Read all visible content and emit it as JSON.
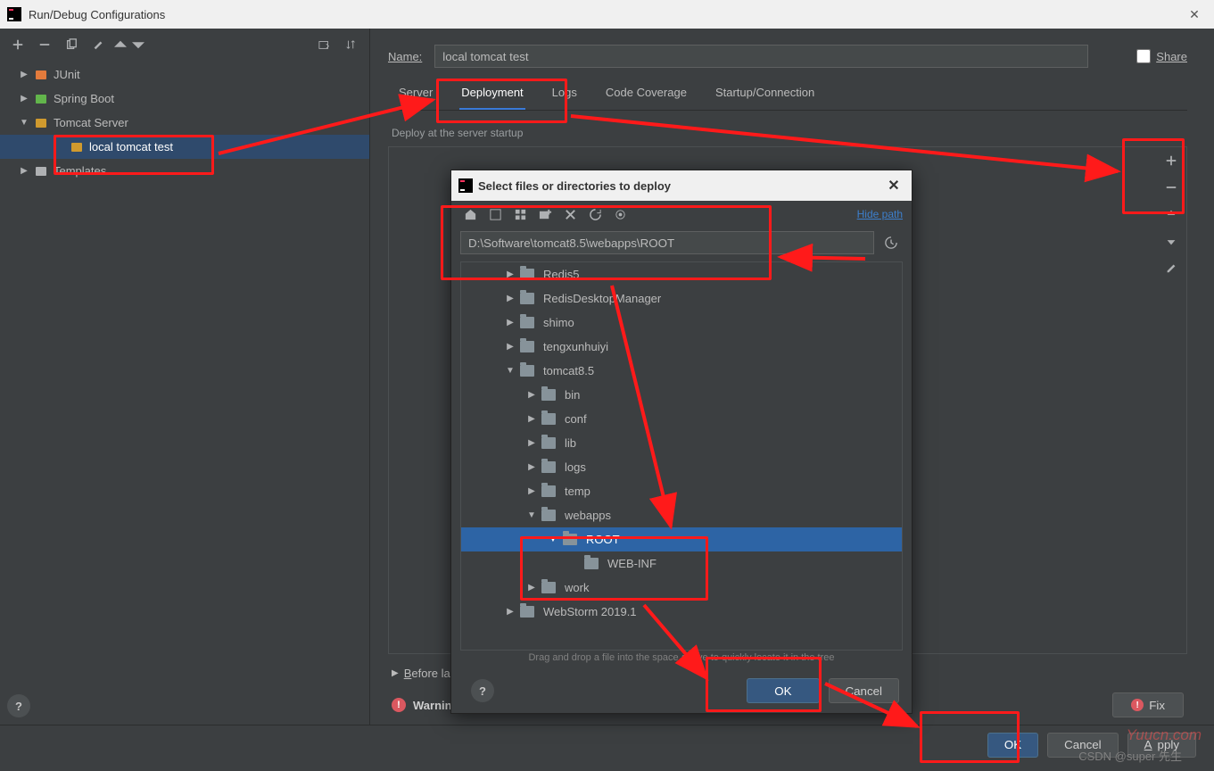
{
  "window": {
    "title": "Run/Debug Configurations"
  },
  "toolbar_icons": [
    "add",
    "remove",
    "copy",
    "wrench",
    "up",
    "down",
    "folder-move",
    "sort"
  ],
  "sidebar": {
    "items": [
      {
        "label": "JUnit",
        "level": 1,
        "arrow": "right",
        "color": "#e47b3c"
      },
      {
        "label": "Spring Boot",
        "level": 1,
        "arrow": "right",
        "color": "#62b54b"
      },
      {
        "label": "Tomcat Server",
        "level": 1,
        "arrow": "down",
        "color": "#d09a2e"
      },
      {
        "label": "local tomcat test",
        "level": 2,
        "arrow": "",
        "color": "#d09a2e",
        "selected": true
      },
      {
        "label": "Templates",
        "level": 1,
        "arrow": "right",
        "color": "#afb1b3"
      }
    ]
  },
  "form": {
    "name_label": "Name:",
    "name_value": "local tomcat test",
    "share_label": "Share"
  },
  "tabs": [
    "Server",
    "Deployment",
    "Logs",
    "Code Coverage",
    "Startup/Connection"
  ],
  "active_tab": 1,
  "deploy_section_label": "Deploy at the server startup",
  "side_tools": [
    "add",
    "remove",
    "up",
    "down",
    "edit"
  ],
  "before_launch_label": "Before launch",
  "warning_label": "Warning",
  "fix_label": "Fix",
  "buttons": {
    "ok": "OK",
    "cancel": "Cancel",
    "apply": "Apply"
  },
  "modal": {
    "title": "Select files or directories to deploy",
    "tool_icons": [
      "home",
      "module",
      "apps",
      "new-folder",
      "delete",
      "refresh",
      "show-hidden"
    ],
    "hide_path_label": "Hide path",
    "path_value": "D:\\Software\\tomcat8.5\\webapps\\ROOT",
    "tree": [
      {
        "label": "Redis5",
        "ind": 48,
        "arrow": "▶"
      },
      {
        "label": "RedisDesktopManager",
        "ind": 48,
        "arrow": "▶"
      },
      {
        "label": "shimo",
        "ind": 48,
        "arrow": "▶"
      },
      {
        "label": "tengxunhuiyi",
        "ind": 48,
        "arrow": "▶"
      },
      {
        "label": "tomcat8.5",
        "ind": 48,
        "arrow": "▼"
      },
      {
        "label": "bin",
        "ind": 72,
        "arrow": "▶"
      },
      {
        "label": "conf",
        "ind": 72,
        "arrow": "▶"
      },
      {
        "label": "lib",
        "ind": 72,
        "arrow": "▶"
      },
      {
        "label": "logs",
        "ind": 72,
        "arrow": "▶"
      },
      {
        "label": "temp",
        "ind": 72,
        "arrow": "▶"
      },
      {
        "label": "webapps",
        "ind": 72,
        "arrow": "▼"
      },
      {
        "label": "ROOT",
        "ind": 96,
        "arrow": "▼",
        "sel": true
      },
      {
        "label": "WEB-INF",
        "ind": 120,
        "arrow": ""
      },
      {
        "label": "work",
        "ind": 72,
        "arrow": "▶"
      },
      {
        "label": "WebStorm 2019.1",
        "ind": 48,
        "arrow": "▶"
      }
    ],
    "hint": "Drag and drop a file into the space above to quickly locate it in the tree",
    "ok": "OK",
    "cancel": "Cancel"
  },
  "watermark": "Yuucn.com",
  "csdn": "CSDN @super 先生"
}
